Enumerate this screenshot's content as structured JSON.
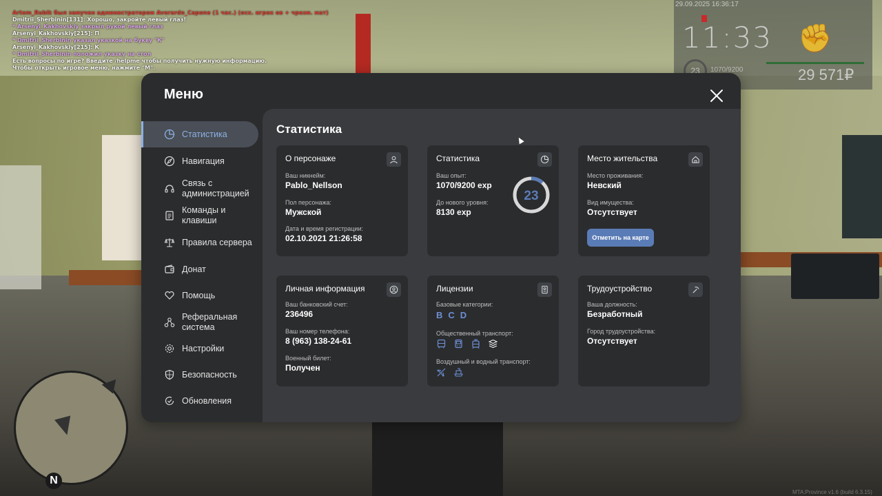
{
  "chat": [
    {
      "text": "Artem_Rubik был замучен администратором Averardo_Capone (1 час.) (оск. игрок ов + чрезм. мат)",
      "color": "#d63a2f"
    },
    {
      "text": "Dmitrii_Sherbinin[131]: Хорошо, закройте левый глаз!",
      "color": "#f1f1f1"
    },
    {
      "text": "* Arsenyi_Kakhovskiy закрыл рукой левый глаз",
      "color": "#d7a2e6"
    },
    {
      "text": "Arsenyi_Kakhovskiy[215]: П",
      "color": "#f1f1f1"
    },
    {
      "text": "* Dmitrii_Sherbinin указал указкой на букву \"К\"",
      "color": "#d7a2e6"
    },
    {
      "text": "Arsenyi_Kakhovskiy[215]: К",
      "color": "#f1f1f1"
    },
    {
      "text": "* Dmitrii_Sherbinin положил указку на стол",
      "color": "#d7a2e6"
    },
    {
      "text": "Есть вопросы по игре? Введите /helpme чтобы получить нужную информацию.",
      "color": "#f1f1f1"
    },
    {
      "text": "Чтобы открыть игровое меню, нажмите \"M\".",
      "color": "#f1f1f1"
    }
  ],
  "hud": {
    "date": "29.09.2025 16:36:17",
    "time": "11:33",
    "level": "23",
    "exp": "1070/9200",
    "money": "29 571₽"
  },
  "minimap": {
    "north": "N"
  },
  "build": "MTA:Province v1.6 (build 6.3.15)",
  "menu": {
    "title": "Меню",
    "close_icon": "close-icon",
    "nav": [
      {
        "label": "Статистика",
        "icon": "pie-chart-icon",
        "active": true
      },
      {
        "label": "Навигация",
        "icon": "compass-icon"
      },
      {
        "label": "Связь с администрацией",
        "icon": "headset-icon"
      },
      {
        "label": "Команды и клавиши",
        "icon": "document-icon"
      },
      {
        "label": "Правила сервера",
        "icon": "scales-icon"
      },
      {
        "label": "Донат",
        "icon": "wallet-icon"
      },
      {
        "label": "Помощь",
        "icon": "heart-hands-icon"
      },
      {
        "label": "Реферальная система",
        "icon": "referral-icon"
      },
      {
        "label": "Настройки",
        "icon": "gear-icon"
      },
      {
        "label": "Безопасность",
        "icon": "shield-icon"
      },
      {
        "label": "Обновления",
        "icon": "refresh-check-icon"
      }
    ],
    "content_title": "Статистика",
    "cards": {
      "character": {
        "title": "О персонаже",
        "nickname_label": "Ваш никнейм:",
        "nickname": "Pablo_Nellson",
        "gender_label": "Пол персонажа:",
        "gender": "Мужской",
        "reg_label": "Дата и время регистрации:",
        "reg": "02.10.2021 21:26:58"
      },
      "stats": {
        "title": "Статистика",
        "exp_label": "Ваш опыт:",
        "exp": "1070/9200 exp",
        "next_label": "До нового уровня:",
        "next": "8130 exp",
        "level": "23",
        "level_progress": 0.116
      },
      "residence": {
        "title": "Место жительства",
        "place_label": "Место проживания:",
        "place": "Невский",
        "property_label": "Вид имущества:",
        "property": "Отсутствует",
        "map_button": "Отметить на карте"
      },
      "personal": {
        "title": "Личная информация",
        "bank_label": "Ваш банковский счет:",
        "bank": "236496",
        "phone_label": "Ваш номер телефона:",
        "phone": "8 (963) 138-24-61",
        "military_label": "Военный билет:",
        "military": "Получен"
      },
      "licenses": {
        "title": "Лицензии",
        "base_label": "Базовые категории:",
        "categories": [
          "B",
          "C",
          "D"
        ],
        "public_label": "Общественный транспорт:",
        "public_icons": [
          "bus-icon",
          "bus-front-icon",
          "tram-icon",
          "trolley-icon"
        ],
        "air_label": "Воздушный и водный транспорт:",
        "air_icons": [
          "plane-icon",
          "boat-icon"
        ]
      },
      "employment": {
        "title": "Трудоустройство",
        "position_label": "Ваша должность:",
        "position": "Безработный",
        "city_label": "Город трудоустройства:",
        "city": "Отсутствует"
      }
    },
    "colors": {
      "accent": "#6d8fd4",
      "button": "#5a7cb6",
      "panel": "#2b2c2e",
      "content": "#3a3b3e"
    }
  }
}
